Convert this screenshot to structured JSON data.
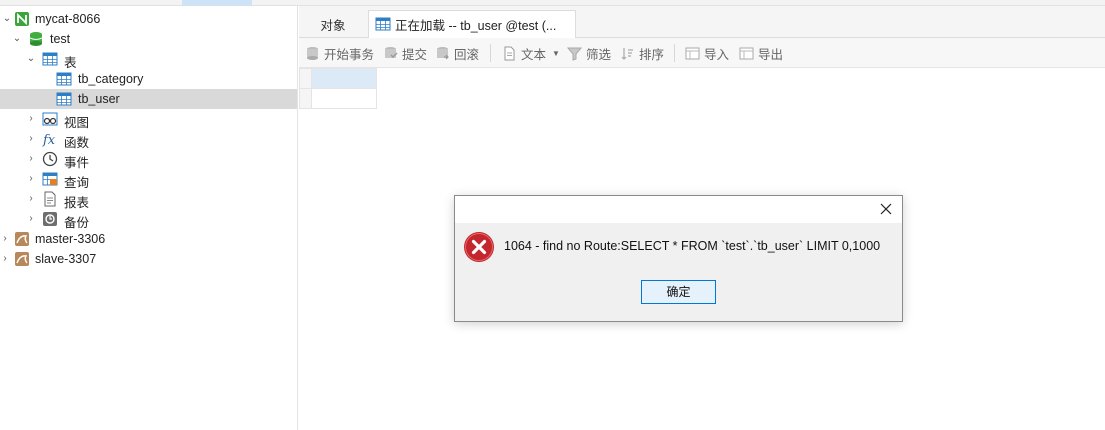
{
  "tree": {
    "connection": "mycat-8066",
    "database": "test",
    "tables_folder": "表",
    "tables": [
      "tb_category",
      "tb_user"
    ],
    "views": "视图",
    "functions": "函数",
    "events": "事件",
    "queries": "查询",
    "reports": "报表",
    "backups": "备份",
    "other_connections": [
      "master-3306",
      "slave-3307"
    ]
  },
  "tabs": {
    "objects": "对象",
    "active": "正在加载 -- tb_user @test (..."
  },
  "toolbar": {
    "begin_transaction": "开始事务",
    "commit": "提交",
    "rollback": "回滚",
    "text": "文本",
    "filter": "筛选",
    "sort": "排序",
    "import": "导入",
    "export": "导出"
  },
  "dialog": {
    "message": "1064 -  find no Route:SELECT * FROM `test`.`tb_user` LIMIT 0,1000",
    "ok_label": "确定"
  },
  "colors": {
    "selected_row": "#d9d9d9",
    "grid_selected_cell": "#dceaf7",
    "error_red": "#c4262e",
    "button_border": "#0078d7"
  }
}
